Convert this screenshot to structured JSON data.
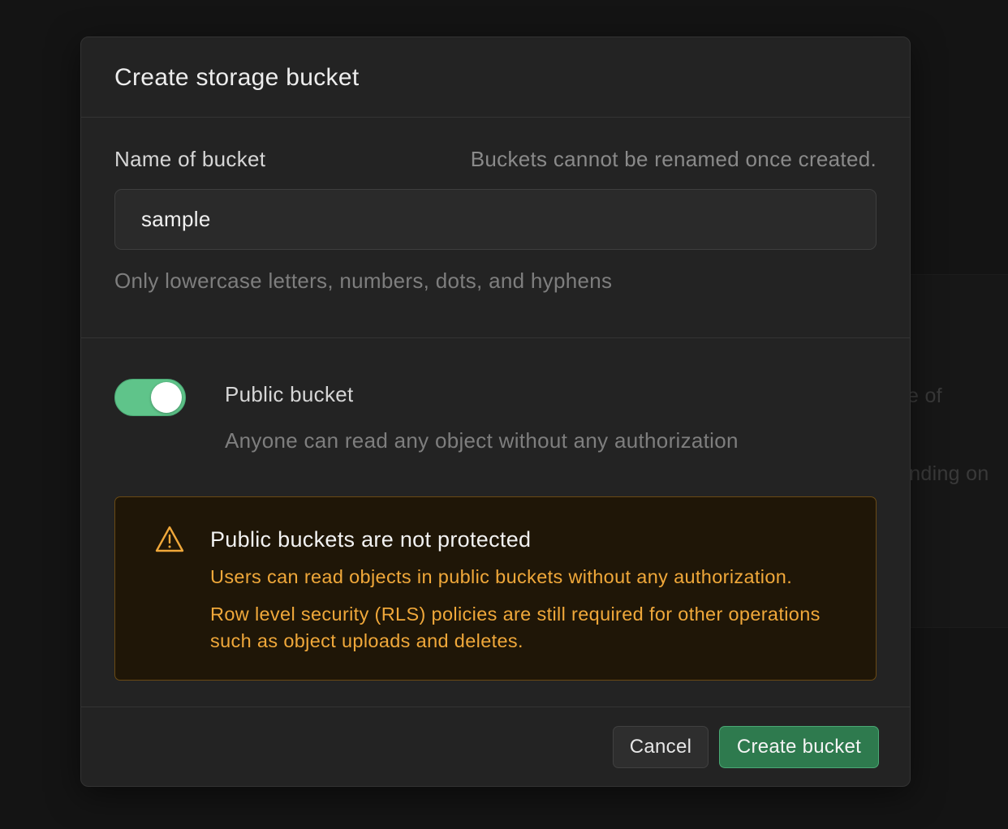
{
  "background": {
    "text_line_1": "e of",
    "text_line_2": "ending on"
  },
  "modal": {
    "title": "Create storage bucket",
    "name_field": {
      "label": "Name of bucket",
      "hint": "Buckets cannot be renamed once created.",
      "value": "sample",
      "description": "Only lowercase letters, numbers, dots, and hyphens"
    },
    "public_toggle": {
      "label": "Public bucket",
      "description": "Anyone can read any object without any authorization",
      "enabled": true
    },
    "warning": {
      "icon": "warning-triangle-icon",
      "title": "Public buckets are not protected",
      "line_1": "Users can read objects in public buckets without any authorization.",
      "line_2": "Row level security (RLS) policies are still required for other operations such as object uploads and deletes."
    },
    "footer": {
      "cancel_label": "Cancel",
      "create_label": "Create bucket"
    }
  },
  "colors": {
    "accent_green": "#5fc48a",
    "primary_button": "#2e7a4e",
    "warning_text": "#f0a83a",
    "warning_bg": "#1f1607"
  }
}
